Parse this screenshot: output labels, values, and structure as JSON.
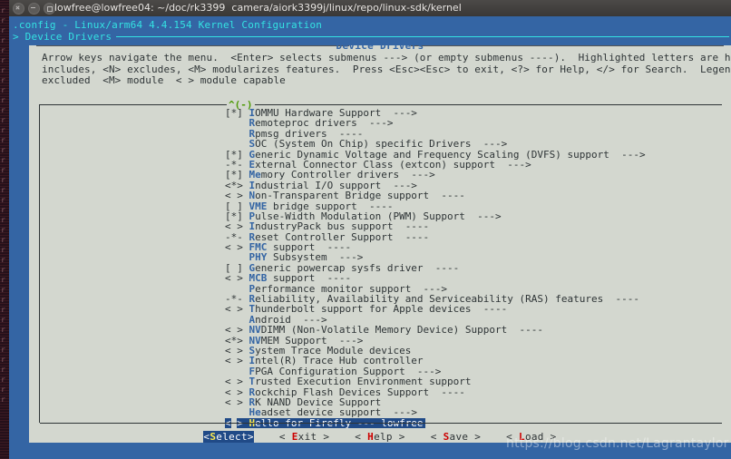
{
  "window": {
    "title": "lowfree@lowfree04: ~/doc/rk3399  camera/aiork3399j/linux/repo/linux-sdk/kernel",
    "controls": [
      "close",
      "minimize",
      "maximize"
    ]
  },
  "menuconfig": {
    "header_line1": ".config - Linux/arm64 4.4.154 Kernel Configuration",
    "header_line2": "> Device Drivers",
    "dialog_title": "Device Drivers",
    "help_lines": [
      "Arrow keys navigate the menu.  <Enter> selects submenus ---> (or empty submenus ----).  Highlighted letters are hotkeys.  Pressing <Y>",
      "includes, <N> excludes, <M> modularizes features.  Press <Esc><Esc> to exit, <?> for Help, </> for Search.  Legend: [*] built-in  [ ]",
      "excluded  <M> module  < > module capable"
    ],
    "scroll_indicator": "^(-)"
  },
  "menu_items": [
    {
      "tag": "[*]",
      "hotkey": "I",
      "before": "",
      "label": "OMMU Hardware Support  --->",
      "selected": false
    },
    {
      "tag": "   ",
      "hotkey": "R",
      "before": "",
      "label": "emoteproc drivers  --->",
      "selected": false
    },
    {
      "tag": "   ",
      "hotkey": "R",
      "before": "",
      "label": "pmsg drivers  ----",
      "selected": false
    },
    {
      "tag": "   ",
      "hotkey": "S",
      "before": "",
      "label": "OC (System On Chip) specific Drivers  --->",
      "selected": false
    },
    {
      "tag": "[*]",
      "hotkey": "G",
      "before": "",
      "label": "eneric Dynamic Voltage and Frequency Scaling (DVFS) support  --->",
      "selected": false
    },
    {
      "tag": "-*-",
      "hotkey": "E",
      "before": "",
      "label": "xternal Connector Class (extcon) support  --->",
      "selected": false
    },
    {
      "tag": "[*]",
      "hotkey": "Me",
      "before": "",
      "label": "mory Controller drivers  --->",
      "selected": false
    },
    {
      "tag": "<*>",
      "hotkey": "I",
      "before": "",
      "label": "ndustrial I/O support  --->",
      "selected": false
    },
    {
      "tag": "< >",
      "hotkey": "N",
      "before": "",
      "label": "on-Transparent Bridge support  ----",
      "selected": false
    },
    {
      "tag": "[ ]",
      "hotkey": "VME",
      "before": "",
      "label": " bridge support  ----",
      "selected": false
    },
    {
      "tag": "[*]",
      "hotkey": "P",
      "before": "",
      "label": "ulse-Width Modulation (PWM) Support  --->",
      "selected": false
    },
    {
      "tag": "< >",
      "hotkey": "I",
      "before": "",
      "label": "ndustryPack bus support  ----",
      "selected": false
    },
    {
      "tag": "-*-",
      "hotkey": "R",
      "before": "",
      "label": "eset Controller Support  ----",
      "selected": false
    },
    {
      "tag": "< >",
      "hotkey": "FMC",
      "before": "",
      "label": " support  ----",
      "selected": false
    },
    {
      "tag": "   ",
      "hotkey": "PHY",
      "before": "",
      "label": " Subsystem  --->",
      "selected": false
    },
    {
      "tag": "[ ]",
      "hotkey": "G",
      "before": "",
      "label": "eneric powercap sysfs driver  ----",
      "selected": false
    },
    {
      "tag": "< >",
      "hotkey": "MCB",
      "before": "",
      "label": " support  ----",
      "selected": false
    },
    {
      "tag": "   ",
      "hotkey": "P",
      "before": "",
      "label": "erformance monitor support  --->",
      "selected": false
    },
    {
      "tag": "-*-",
      "hotkey": "R",
      "before": "",
      "label": "eliability, Availability and Serviceability (RAS) features  ----",
      "selected": false
    },
    {
      "tag": "< >",
      "hotkey": "T",
      "before": "",
      "label": "hunderbolt support for Apple devices  ----",
      "selected": false
    },
    {
      "tag": "   ",
      "hotkey": "A",
      "before": "",
      "label": "ndroid  --->",
      "selected": false
    },
    {
      "tag": "< >",
      "hotkey": "NV",
      "before": "",
      "label": "DIMM (Non-Volatile Memory Device) Support  ----",
      "selected": false
    },
    {
      "tag": "<*>",
      "hotkey": "NV",
      "before": "",
      "label": "MEM Support  --->",
      "selected": false
    },
    {
      "tag": "< >",
      "hotkey": "S",
      "before": "",
      "label": "ystem Trace Module devices",
      "selected": false
    },
    {
      "tag": "< >",
      "hotkey": "I",
      "before": "",
      "label": "ntel(R) Trace Hub controller",
      "selected": false
    },
    {
      "tag": "   ",
      "hotkey": "F",
      "before": "",
      "label": "PGA Configuration Support  --->",
      "selected": false
    },
    {
      "tag": "< >",
      "hotkey": "T",
      "before": "",
      "label": "rusted Execution Environment support",
      "selected": false
    },
    {
      "tag": "< >",
      "hotkey": "R",
      "before": "",
      "label": "ockchip Flash Devices Support  ----",
      "selected": false
    },
    {
      "tag": "< >",
      "hotkey": "R",
      "before": "",
      "label": "K NAND Device Support",
      "selected": false
    },
    {
      "tag": "   ",
      "hotkey": "He",
      "before": "",
      "label": "adset device support  --->",
      "selected": false
    },
    {
      "tag": "< >",
      "hotkey": "H",
      "before": "",
      "label": "ello for Firefly --- lowfree",
      "selected": true
    }
  ],
  "buttons": [
    {
      "name": "select",
      "left": "<",
      "hotkey": "S",
      "rest": "elect",
      "right": ">",
      "active": true
    },
    {
      "name": "exit",
      "left": "< ",
      "hotkey": "E",
      "rest": "xit",
      "right": " >",
      "active": false
    },
    {
      "name": "help",
      "left": "< ",
      "hotkey": "H",
      "rest": "elp",
      "right": " >",
      "active": false
    },
    {
      "name": "save",
      "left": "< ",
      "hotkey": "S",
      "rest": "ave",
      "right": " >",
      "active": false
    },
    {
      "name": "load",
      "left": "< ",
      "hotkey": "L",
      "rest": "oad",
      "right": " >",
      "active": false
    }
  ],
  "watermark": "https://blog.csdn.net/Lagrantaylor",
  "colors": {
    "backdrop_blue": "#3465a4",
    "dialog_bg": "#d3d7cf",
    "highlight_bg": "#204a87",
    "hotkey_blue": "#3465a4",
    "hotkey_red": "#cc0000",
    "hotkey_yellow": "#fce94f",
    "header_cyan": "#34e2e2",
    "scroll_green": "#4e9a06",
    "titlebar": "#3a3836"
  }
}
